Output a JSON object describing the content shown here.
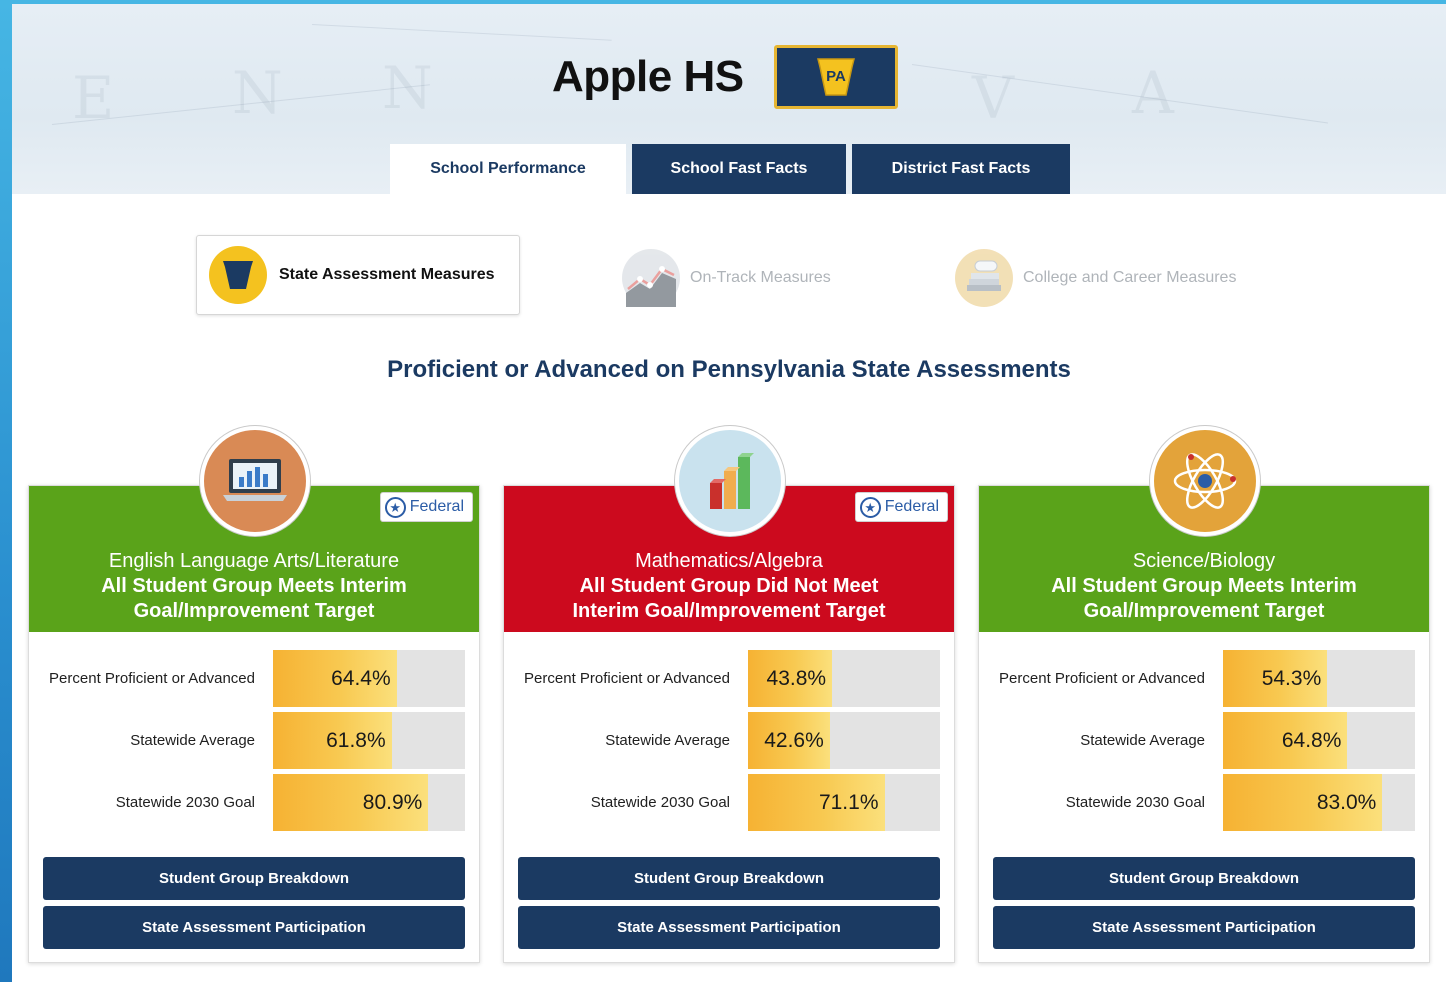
{
  "header": {
    "school_name": "Apple HS",
    "state_badge": "PA"
  },
  "tabs": [
    {
      "label": "School Performance",
      "active": true
    },
    {
      "label": "School Fast Facts",
      "active": false
    },
    {
      "label": "District Fast Facts",
      "active": false
    }
  ],
  "measures": [
    {
      "label": "State Assessment Measures",
      "icon": "keystone-icon",
      "active": true
    },
    {
      "label": "On-Track Measures",
      "icon": "trend-chart-icon",
      "active": false
    },
    {
      "label": "College and Career Measures",
      "icon": "diploma-books-icon",
      "active": false
    }
  ],
  "section_title": "Proficient or Advanced on Pennsylvania State Assessments",
  "colors": {
    "navy": "#1b3a62",
    "meets_green": "#5aa31a",
    "not_met_red": "#cc0a1e",
    "bar_gold": "#f6b233"
  },
  "cards": [
    {
      "subject": "English Language Arts/Literature",
      "status": "All Student Group Meets Interim Goal/Improvement Target",
      "status_color": "green",
      "federal": "Federal",
      "icon": "laptop-chart-icon",
      "metrics": [
        {
          "label": "Percent Proficient or Advanced",
          "value": "64.4%",
          "pct": 64.4
        },
        {
          "label": "Statewide Average",
          "value": "61.8%",
          "pct": 61.8
        },
        {
          "label": "Statewide 2030 Goal",
          "value": "80.9%",
          "pct": 80.9
        }
      ],
      "buttons": [
        "Student Group Breakdown",
        "State Assessment Participation"
      ]
    },
    {
      "subject": "Mathematics/Algebra",
      "status": "All Student Group Did Not Meet Interim Goal/Improvement Target",
      "status_color": "red",
      "federal": "Federal",
      "icon": "bar-chart-blocks-icon",
      "metrics": [
        {
          "label": "Percent Proficient or Advanced",
          "value": "43.8%",
          "pct": 43.8
        },
        {
          "label": "Statewide Average",
          "value": "42.6%",
          "pct": 42.6
        },
        {
          "label": "Statewide 2030 Goal",
          "value": "71.1%",
          "pct": 71.1
        }
      ],
      "buttons": [
        "Student Group Breakdown",
        "State Assessment Participation"
      ]
    },
    {
      "subject": "Science/Biology",
      "status": "All Student Group Meets Interim Goal/Improvement Target",
      "status_color": "green",
      "federal": "",
      "icon": "atom-icon",
      "metrics": [
        {
          "label": "Percent Proficient or Advanced",
          "value": "54.3%",
          "pct": 54.3
        },
        {
          "label": "Statewide Average",
          "value": "64.8%",
          "pct": 64.8
        },
        {
          "label": "Statewide 2030 Goal",
          "value": "83.0%",
          "pct": 83.0
        }
      ],
      "buttons": [
        "Student Group Breakdown",
        "State Assessment Participation"
      ]
    }
  ]
}
